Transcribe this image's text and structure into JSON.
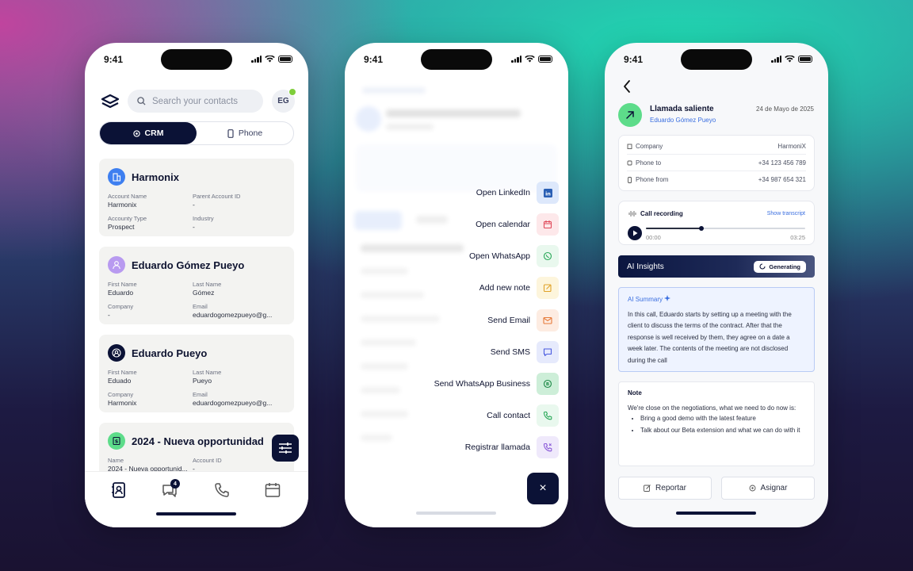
{
  "status_time": "9:41",
  "crm": {
    "search_placeholder": "Search your contacts",
    "avatar_initials": "EG",
    "segment": {
      "crm": "CRM",
      "phone": "Phone"
    },
    "cards": [
      {
        "title": "Harmonix",
        "fields": [
          {
            "label": "Account Name",
            "value": "Harmonix"
          },
          {
            "label": "Parent Account ID",
            "value": "-"
          },
          {
            "label": "Accounty Type",
            "value": "Prospect"
          },
          {
            "label": "Industry",
            "value": "-"
          }
        ]
      },
      {
        "title": "Eduardo Gómez Pueyo",
        "fields": [
          {
            "label": "First Name",
            "value": "Eduardo"
          },
          {
            "label": "Last Name",
            "value": "Gómez"
          },
          {
            "label": "Company",
            "value": "-"
          },
          {
            "label": "Email",
            "value": "eduardogomezpueyo@g..."
          }
        ]
      },
      {
        "title": "Eduardo Pueyo",
        "fields": [
          {
            "label": "First Name",
            "value": "Eduado"
          },
          {
            "label": "Last Name",
            "value": "Pueyo"
          },
          {
            "label": "Company",
            "value": "Harmonix"
          },
          {
            "label": "Email",
            "value": "eduardogomezpueyo@g..."
          }
        ]
      },
      {
        "title": "2024 - Nueva opportunidad",
        "fields": [
          {
            "label": "Name",
            "value": "2024 - Nueva opportunid..."
          },
          {
            "label": "Account ID",
            "value": "-"
          }
        ]
      }
    ],
    "messages_badge": "4"
  },
  "actions": {
    "items": [
      {
        "label": "Open LinkedIn",
        "icon": "linkedin-icon",
        "color": "#dde8fb"
      },
      {
        "label": "Open calendar",
        "icon": "calendar-icon",
        "color": "#fde8ea"
      },
      {
        "label": "Open WhatsApp",
        "icon": "whatsapp-icon",
        "color": "#e9f8ee"
      },
      {
        "label": "Add new note",
        "icon": "note-icon",
        "color": "#fdf5dc"
      },
      {
        "label": "Send Email",
        "icon": "email-icon",
        "color": "#fdece2"
      },
      {
        "label": "Send SMS",
        "icon": "sms-icon",
        "color": "#e6eafc"
      },
      {
        "label": "Send WhatsApp Business",
        "icon": "whatsapp-business-icon",
        "color": "#cdeed8"
      },
      {
        "label": "Call contact",
        "icon": "phone-icon",
        "color": "#e9f8ee"
      },
      {
        "label": "Registrar llamada",
        "icon": "phone-log-icon",
        "color": "#efe9fb"
      }
    ],
    "close": "×"
  },
  "call": {
    "title": "Llamada saliente",
    "contact": "Eduardo Gómez Pueyo",
    "date": "24 de Mayo de 2025",
    "details": [
      {
        "key": "Company",
        "value": "HarmoniX"
      },
      {
        "key": "Phone to",
        "value": "+34 123 456 789"
      },
      {
        "key": "Phone from",
        "value": "+34 987 654 321"
      }
    ],
    "recording": {
      "title": "Call recording",
      "link": "Show transcript",
      "elapsed": "00:00",
      "total": "03:25",
      "progress": 0.35
    },
    "ai": {
      "title": "AI Insights",
      "status": "Generating"
    },
    "summary": {
      "title": "AI Summary",
      "text": "In this call, Eduardo starts by setting up a meeting with the client to discuss the terms of the contract. After that the response is well received by them, they agree on a date a week later. The contents of the meeting are not disclosed during the call"
    },
    "note": {
      "title": "Note",
      "text": "We're close on the negotiations, what we need to do now is:",
      "bullets": [
        "Bring a good demo with the latest feature",
        "Talk about our Beta extension and what we can do with it"
      ]
    },
    "buttons": {
      "report": "Reportar",
      "assign": "Asignar"
    }
  }
}
